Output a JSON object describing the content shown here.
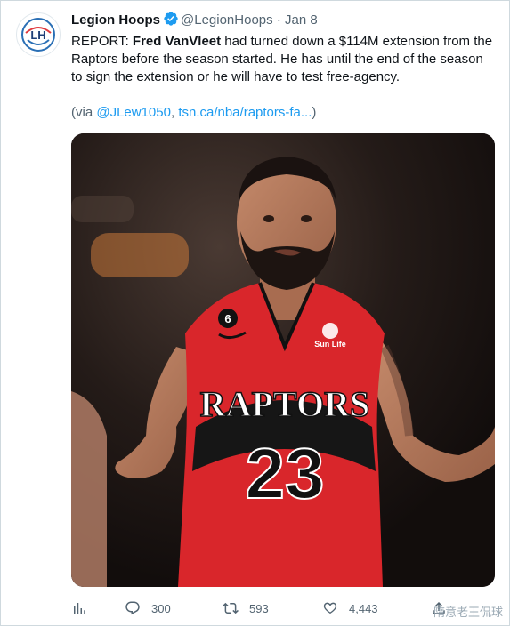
{
  "author": {
    "name": "Legion Hoops",
    "handle": "@LegionHoops",
    "separator": "·",
    "time": "Jan 8",
    "avatar_monogram": "LH"
  },
  "tweet": {
    "report_label": "REPORT:",
    "player_name": "Fred VanVleet",
    "body_rest": " had turned down a $114M extension from the Raptors before the season started. He has until the end of the season to sign the extension or he will have to test free-agency.",
    "via_open": "(via ",
    "via_mention": "@JLew1050",
    "via_sep": ", ",
    "via_link": "tsn.ca/nba/raptors-fa...",
    "via_close": ")"
  },
  "media": {
    "jersey_team": "RAPTORS",
    "jersey_number": "23",
    "patch_number": "6",
    "sponsor": "Sun Life"
  },
  "actions": {
    "replies": "300",
    "retweets": "593",
    "likes": "4,443"
  },
  "watermark": "隋意老王侃球",
  "colors": {
    "accent": "#1d9bf0",
    "text": "#0f1419",
    "muted": "#536471",
    "jersey_red": "#d9262b"
  }
}
